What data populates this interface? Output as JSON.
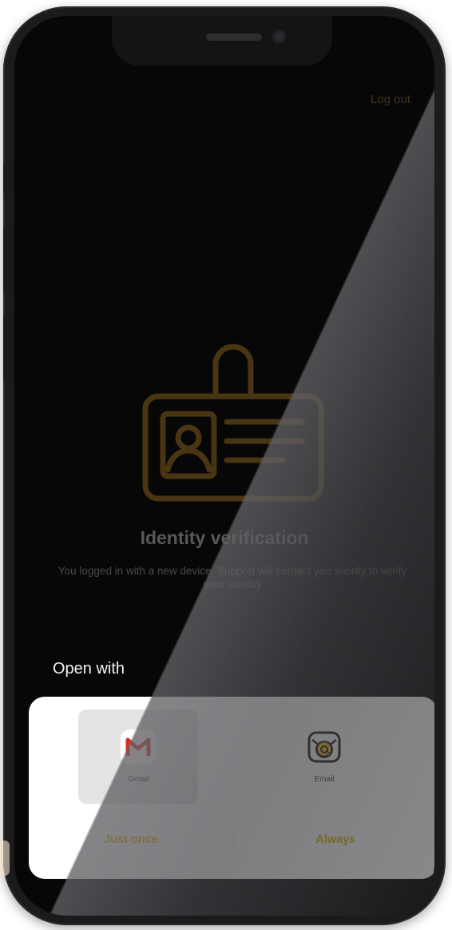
{
  "header": {
    "logout_label": "Log out"
  },
  "verification": {
    "title": "Identity verification",
    "message": "You logged in with a new device. Support will contact you shortly to verify your identity"
  },
  "chooser": {
    "heading": "Open with",
    "apps": [
      {
        "label": "Gmail",
        "icon": "gmail-icon",
        "selected": true
      },
      {
        "label": "Email",
        "icon": "email-icon",
        "selected": false
      }
    ],
    "actions": {
      "just_once": "Just once",
      "always": "Always"
    }
  },
  "colors": {
    "accent": "#e8b400",
    "illustration": "#4a3512",
    "screen_bg": "#070708",
    "sheet_bg": "#ffffff",
    "selected_bg": "#e4e4e4"
  }
}
